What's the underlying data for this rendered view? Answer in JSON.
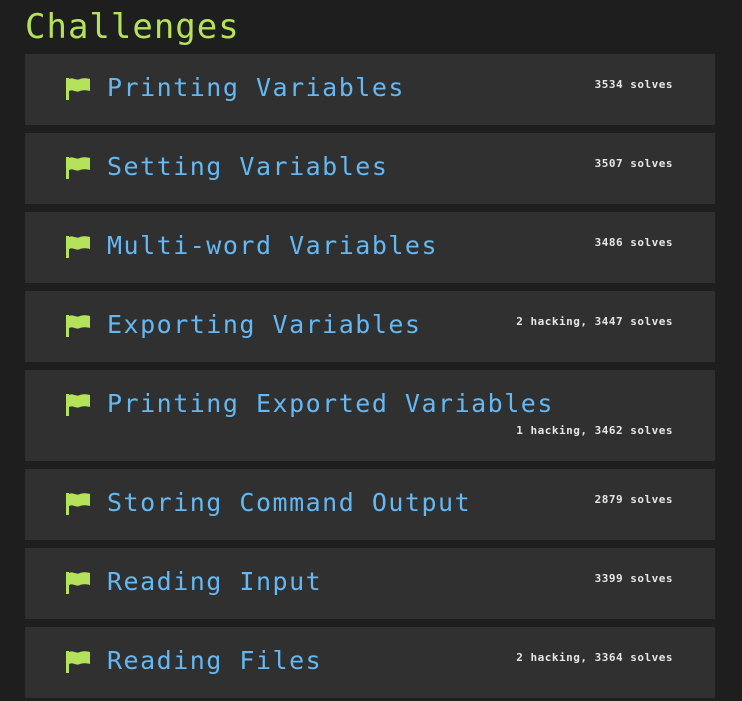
{
  "page": {
    "title": "Challenges"
  },
  "colors": {
    "background": "#1e1e1e",
    "card": "#303030",
    "title": "#b4e35b",
    "flag": "#b4e35b",
    "challenge_name": "#64b8f3",
    "solves_text": "#e6e6e6"
  },
  "challenges": [
    {
      "name": "Printing Variables",
      "stats": "3534 solves",
      "icon": "flag-icon"
    },
    {
      "name": "Setting Variables",
      "stats": "3507 solves",
      "icon": "flag-icon"
    },
    {
      "name": "Multi-word Variables",
      "stats": "3486 solves",
      "icon": "flag-icon"
    },
    {
      "name": "Exporting Variables",
      "stats": "2 hacking, 3447 solves",
      "icon": "flag-icon"
    },
    {
      "name": "Printing Exported Variables",
      "stats": "1 hacking, 3462 solves",
      "icon": "flag-icon"
    },
    {
      "name": "Storing Command Output",
      "stats": "2879 solves",
      "icon": "flag-icon"
    },
    {
      "name": "Reading Input",
      "stats": "3399 solves",
      "icon": "flag-icon"
    },
    {
      "name": "Reading Files",
      "stats": "2 hacking, 3364 solves",
      "icon": "flag-icon"
    }
  ]
}
